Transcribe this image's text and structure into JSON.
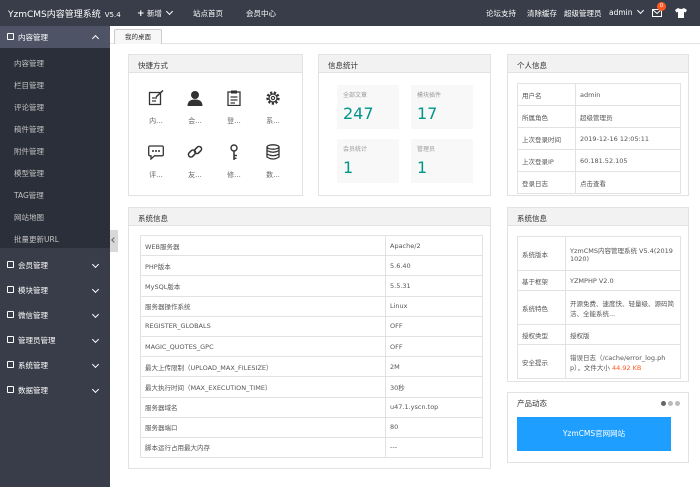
{
  "header": {
    "logo": "YzmCMS内容管理系统",
    "version": "V5.4",
    "new_label": "新增",
    "home_label": "站点首页",
    "member_label": "会员中心",
    "forum_label": "论坛支持",
    "clear_cache_label": "清除缓存",
    "role_label": "超级管理员",
    "user_label": "admin",
    "msg_count": "0"
  },
  "sidebar": {
    "content_title": "内容管理",
    "content_items": [
      "内容管理",
      "栏目管理",
      "评论管理",
      "稿件管理",
      "附件管理",
      "模型管理",
      "TAG管理",
      "网站地图",
      "批量更新URL"
    ],
    "groups": [
      "会员管理",
      "模块管理",
      "微信管理",
      "管理员管理",
      "系统管理",
      "数据管理"
    ]
  },
  "tabs": [
    "我的桌面"
  ],
  "quick": {
    "title": "快捷方式",
    "items": [
      {
        "icon": "edit-icon",
        "label": "内..."
      },
      {
        "icon": "user-icon",
        "label": "会..."
      },
      {
        "icon": "clipboard-icon",
        "label": "登..."
      },
      {
        "icon": "gear-icon",
        "label": "系..."
      },
      {
        "icon": "comment-icon",
        "label": "评..."
      },
      {
        "icon": "link-icon",
        "label": "友..."
      },
      {
        "icon": "key-icon",
        "label": "修..."
      },
      {
        "icon": "database-icon",
        "label": "数..."
      }
    ]
  },
  "stats": {
    "title": "信息统计",
    "items": [
      {
        "label": "全部文章",
        "value": "247"
      },
      {
        "label": "模块插件",
        "value": "17"
      },
      {
        "label": "会员统计",
        "value": "1"
      },
      {
        "label": "管理员",
        "value": "1"
      }
    ]
  },
  "profile": {
    "title": "个人信息",
    "rows": [
      [
        "用户名",
        "admin"
      ],
      [
        "所属角色",
        "超级管理员"
      ],
      [
        "上次登录时间",
        "2019-12-16 12:05:11"
      ],
      [
        "上次登录IP",
        "60.181.52.105"
      ],
      [
        "登录日志",
        "点击查看"
      ]
    ]
  },
  "sysinfo": {
    "title": "系统信息",
    "rows": [
      [
        "WEB服务器",
        "Apache/2"
      ],
      [
        "PHP版本",
        "5.6.40"
      ],
      [
        "MySQL版本",
        "5.5.31"
      ],
      [
        "服务器操作系统",
        "Linux"
      ],
      [
        "REGISTER_GLOBALS",
        "OFF"
      ],
      [
        "MAGIC_QUOTES_GPC",
        "OFF"
      ],
      [
        "最大上传限制（UPLOAD_MAX_FILESIZE）",
        "2M"
      ],
      [
        "最大执行时间（MAX_EXECUTION_TIME）",
        "30秒"
      ],
      [
        "服务器域名",
        "u47.1.yscn.top"
      ],
      [
        "服务器端口",
        "80"
      ],
      [
        "脚本运行占用最大内存",
        "---"
      ]
    ]
  },
  "sysinfo2": {
    "title": "系统信息",
    "rows": [
      [
        "系统版本",
        "YzmCMS内容管理系统 V5.4(20191020)"
      ],
      [
        "基于框架",
        "YZMPHP V2.0"
      ],
      [
        "系统特色",
        "开源免费、速度快、轻量级、源码简洁、全能系统..."
      ],
      [
        "授权类型",
        "授权版"
      ],
      [
        "安全提示",
        "错误日志（/cache/error_log.php），文件大小 "
      ]
    ],
    "log_size": "44.92 KB"
  },
  "news": {
    "title": "产品动态",
    "button_label": "YzmCMS官网网站"
  },
  "colors": {
    "topbar": "#393D49",
    "sidebar_sub": "#2B2F3A",
    "accent": "#009688",
    "button": "#1E9FFF",
    "warning": "#FF5722"
  }
}
